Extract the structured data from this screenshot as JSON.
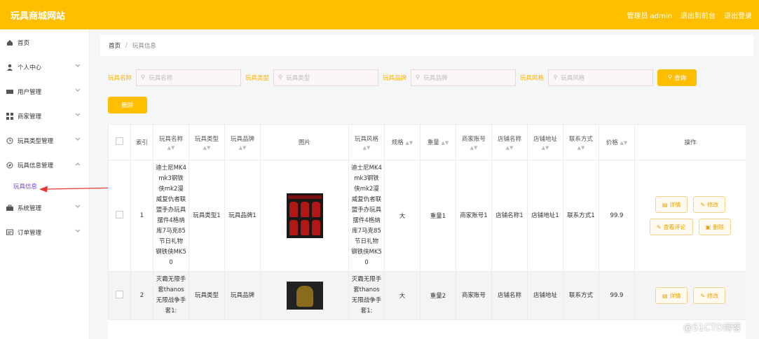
{
  "app": {
    "title": "玩具商城网站",
    "user_label": "管理员 admin",
    "back_label": "退出到前台",
    "logout_label": "退出登录"
  },
  "sidebar": {
    "items": [
      {
        "label": "首页",
        "icon": "home-icon"
      },
      {
        "label": "个人中心",
        "icon": "user-icon"
      },
      {
        "label": "用户管理",
        "icon": "users-icon"
      },
      {
        "label": "商家管理",
        "icon": "grid-icon"
      },
      {
        "label": "玩具类型管理",
        "icon": "clock-icon"
      },
      {
        "label": "玩具信息管理",
        "icon": "compass-icon"
      },
      {
        "label": "系统管理",
        "icon": "toolbox-icon"
      },
      {
        "label": "订单管理",
        "icon": "message-icon"
      }
    ],
    "active_sub": "玩具信息"
  },
  "breadcrumb": {
    "home": "首页",
    "sep": "/",
    "current": "玩具信息"
  },
  "filters": {
    "name_label": "玩具名称",
    "name_placeholder": "玩具名称",
    "type_label": "玩具类型",
    "type_placeholder": "玩具类型",
    "brand_label": "玩具品牌",
    "brand_placeholder": "玩具品牌",
    "style_label": "玩具风格",
    "style_placeholder": "玩具风格",
    "search_label": "查询"
  },
  "delete_label": "删除",
  "table": {
    "headers": [
      "索引",
      "玩具名称",
      "玩具类型",
      "玩具品牌",
      "图片",
      "玩具风格",
      "规格",
      "重量",
      "商家账号",
      "店铺名称",
      "店铺地址",
      "联系方式",
      "价格",
      "操作"
    ],
    "rows": [
      {
        "index": "1",
        "name": "迪士尼MK4mk3钢铁侠mk2漫威复仇者联盟手办玩具摆件4格纳库7马克85节日礼物 钢铁侠MK50",
        "type": "玩具类型1",
        "brand": "玩具品牌1",
        "style": "迪士尼MK4mk3钢铁侠mk2漫威复仇者联盟手办玩具摆件4格纳库7马克85节日礼物 钢铁侠MK50",
        "spec": "大",
        "weight": "重量1",
        "account": "商家账号1",
        "shop": "店铺名称1",
        "address": "店铺地址1",
        "contact": "联系方式1",
        "price": "99.9"
      },
      {
        "index": "2",
        "name": "灭霸无限手套thanos无限战争手套1:",
        "type": "玩具类型",
        "brand": "玩具品牌",
        "style": "灭霸无限手套thanos无限战争手套1:",
        "spec": "大",
        "weight": "重量2",
        "account": "商家账号",
        "shop": "店铺名称",
        "address": "店铺地址",
        "contact": "联系方式",
        "price": "99.9"
      }
    ],
    "ops": {
      "detail": "详情",
      "edit": "修改",
      "review": "查看评论",
      "delete": "删除"
    }
  },
  "colors": {
    "accent": "#ffbf00",
    "active_menu": "#7b3fe4",
    "arrow": "#e53935"
  },
  "watermark": "@51CTO博客"
}
